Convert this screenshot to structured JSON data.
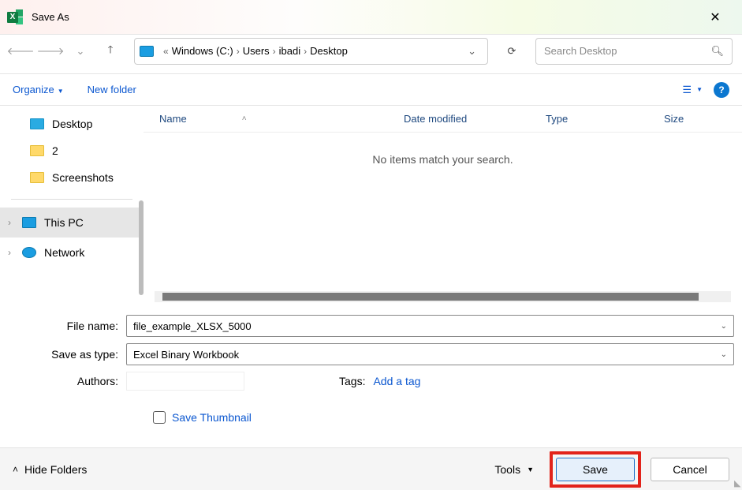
{
  "title": "Save As",
  "breadcrumb": {
    "prefix_ellipsis": "«",
    "parts": [
      "Windows (C:)",
      "Users",
      "ibadi",
      "Desktop"
    ],
    "sep": "›"
  },
  "search": {
    "placeholder": "Search Desktop"
  },
  "toolbar": {
    "organize": "Organize",
    "new_folder": "New folder"
  },
  "sidebar": {
    "quick": [
      {
        "label": "Desktop",
        "color": "blue"
      },
      {
        "label": "2",
        "color": "yellow"
      },
      {
        "label": "Screenshots",
        "color": "yellow"
      }
    ],
    "tree": [
      {
        "label": "This PC",
        "icon": "pc",
        "selected": true
      },
      {
        "label": "Network",
        "icon": "net",
        "selected": false
      }
    ]
  },
  "list": {
    "columns": {
      "name": "Name",
      "date": "Date modified",
      "type": "Type",
      "size": "Size"
    },
    "empty_msg": "No items match your search."
  },
  "form": {
    "filename_label": "File name:",
    "filename_value": "file_example_XLSX_5000",
    "type_label": "Save as type:",
    "type_value": "Excel Binary Workbook",
    "authors_label": "Authors:",
    "tags_label": "Tags:",
    "tags_link": "Add a tag",
    "save_thumbnail": "Save Thumbnail"
  },
  "bottom": {
    "hide_folders": "Hide Folders",
    "tools": "Tools",
    "save": "Save",
    "cancel": "Cancel"
  }
}
